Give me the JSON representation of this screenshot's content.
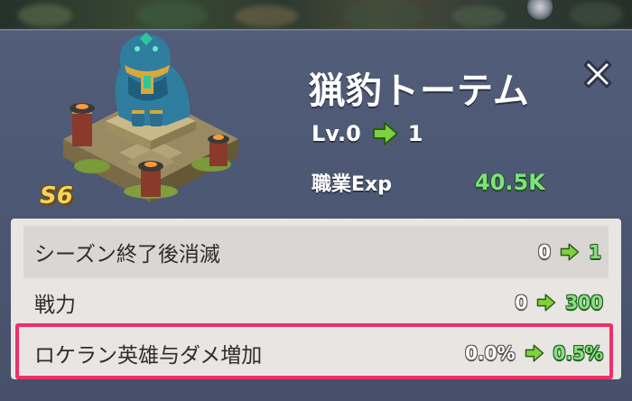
{
  "building": {
    "name": "猟豹トーテム",
    "season_badge": "S6"
  },
  "level": {
    "label": "Lv.0",
    "next": "1"
  },
  "job_exp": {
    "label": "職業Exp",
    "value": "40.5K"
  },
  "stats": [
    {
      "label": "シーズン終了後消滅",
      "from": "0",
      "to": "1"
    },
    {
      "label": "戦力",
      "from": "0",
      "to": "300"
    },
    {
      "label": "ロケラン英雄与ダメ増加",
      "from": "0.0%",
      "to": "0.5%"
    }
  ],
  "icons": {
    "close": "close-icon",
    "arrow": "green-arrow-icon",
    "search": "magnifier-icon"
  },
  "colors": {
    "panel": "#4f5a76",
    "accent_green": "#86e07d",
    "highlight": "#ee2f6a",
    "badge_gold": "#f6d45a"
  }
}
